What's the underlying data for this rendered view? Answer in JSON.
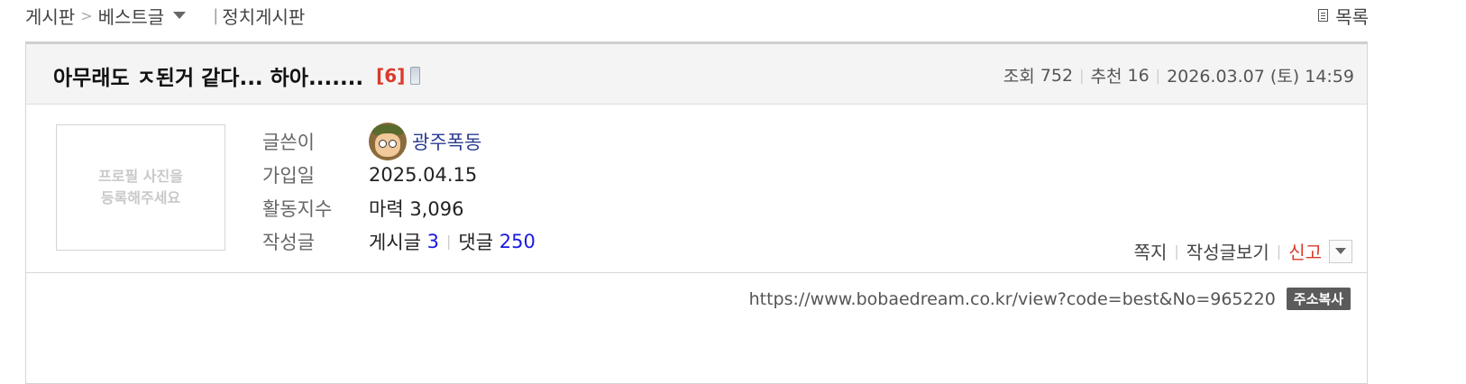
{
  "breadcrumb": {
    "board": "게시판",
    "separator": ">",
    "category": "베스트글",
    "divider": "|",
    "sub_board": "정치게시판"
  },
  "list_label": "목록",
  "post": {
    "title": "아무래도 ㅈ된거 같다... 하아.......",
    "comment_count": "[6]",
    "views_label": "조회",
    "views": "752",
    "recommend_label": "추천",
    "recommend": "16",
    "datetime": "2026.03.07 (토) 14:59"
  },
  "profile": {
    "photo_placeholder_line1": "프로필 사진을",
    "photo_placeholder_line2": "등록해주세요",
    "writer_label": "글쓴이",
    "writer": "광주폭동",
    "joined_label": "가입일",
    "joined": "2025.04.15",
    "activity_label": "활동지수",
    "activity": "마력 3,096",
    "posts_label": "작성글",
    "posts_prefix": "게시글",
    "posts_count": "3",
    "comments_prefix": "댓글",
    "comments_count": "250"
  },
  "actions": {
    "message": "쪽지",
    "view_posts": "작성글보기",
    "report": "신고"
  },
  "url": {
    "value": "https://www.bobaedream.co.kr/view?code=best&No=965220",
    "copy_label": "주소복사"
  },
  "colors": {
    "accent_red": "#d93a2b",
    "link_blue": "#1a1ae0",
    "nick_blue": "#2a3d8f"
  },
  "icons": [
    "dropdown-triangle-icon",
    "list-doc-icon",
    "mobile-phone-icon",
    "avatar-icon",
    "chevron-down-icon"
  ]
}
